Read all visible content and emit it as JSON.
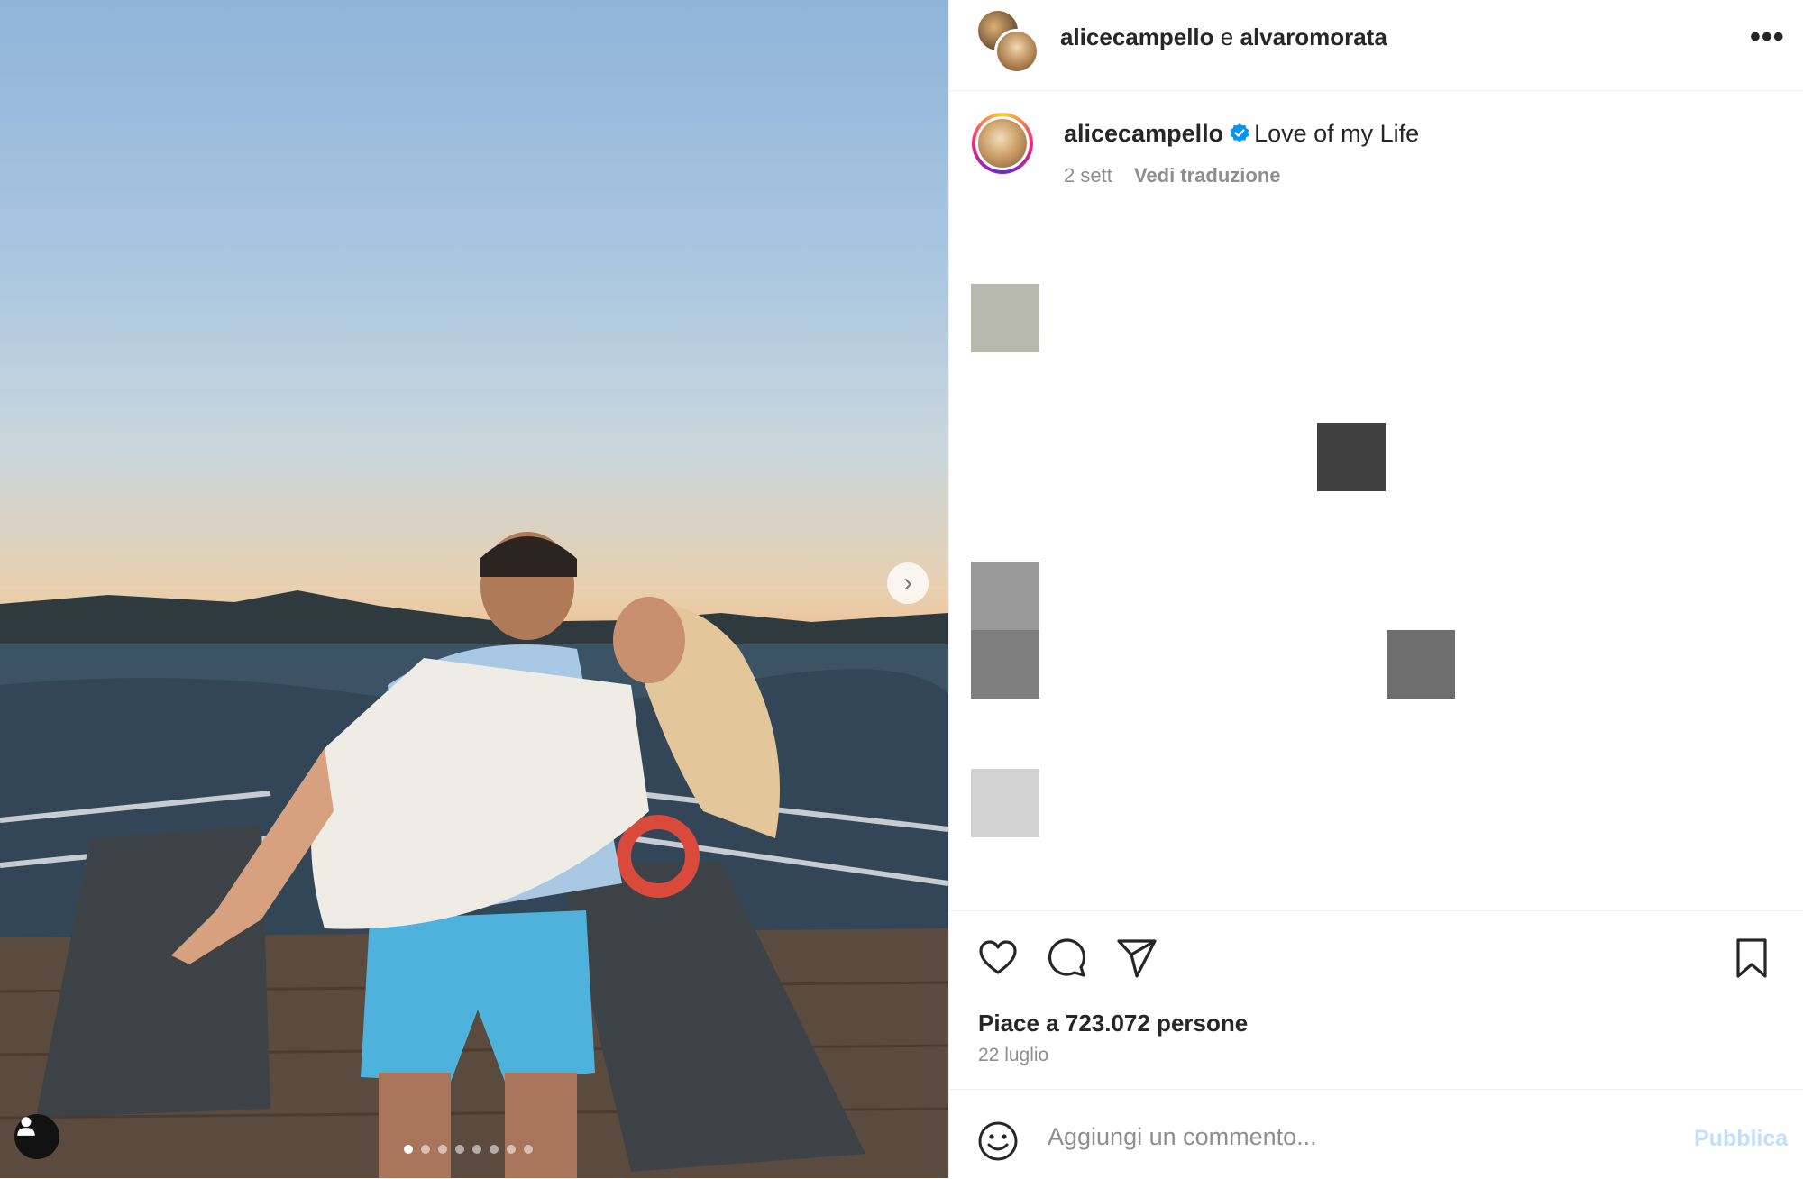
{
  "post": {
    "carousel": {
      "total": 8,
      "active": 1
    }
  },
  "header": {
    "author_a": "alicecampello",
    "joiner": "e",
    "author_b": "alvaromorata"
  },
  "caption": {
    "username": "alicecampello",
    "text": "Love of my Life",
    "time": "2 sett",
    "translate": "Vedi traduzione"
  },
  "actions": {
    "likes": "Piace a 723.072 persone",
    "date": "22 luglio"
  },
  "comment": {
    "placeholder": "Aggiungi un commento...",
    "publish": "Pubblica"
  },
  "colors": {
    "verified": "#0095f6",
    "publish_disabled": "#c0dffd",
    "text_secondary": "#8e8e8e"
  }
}
